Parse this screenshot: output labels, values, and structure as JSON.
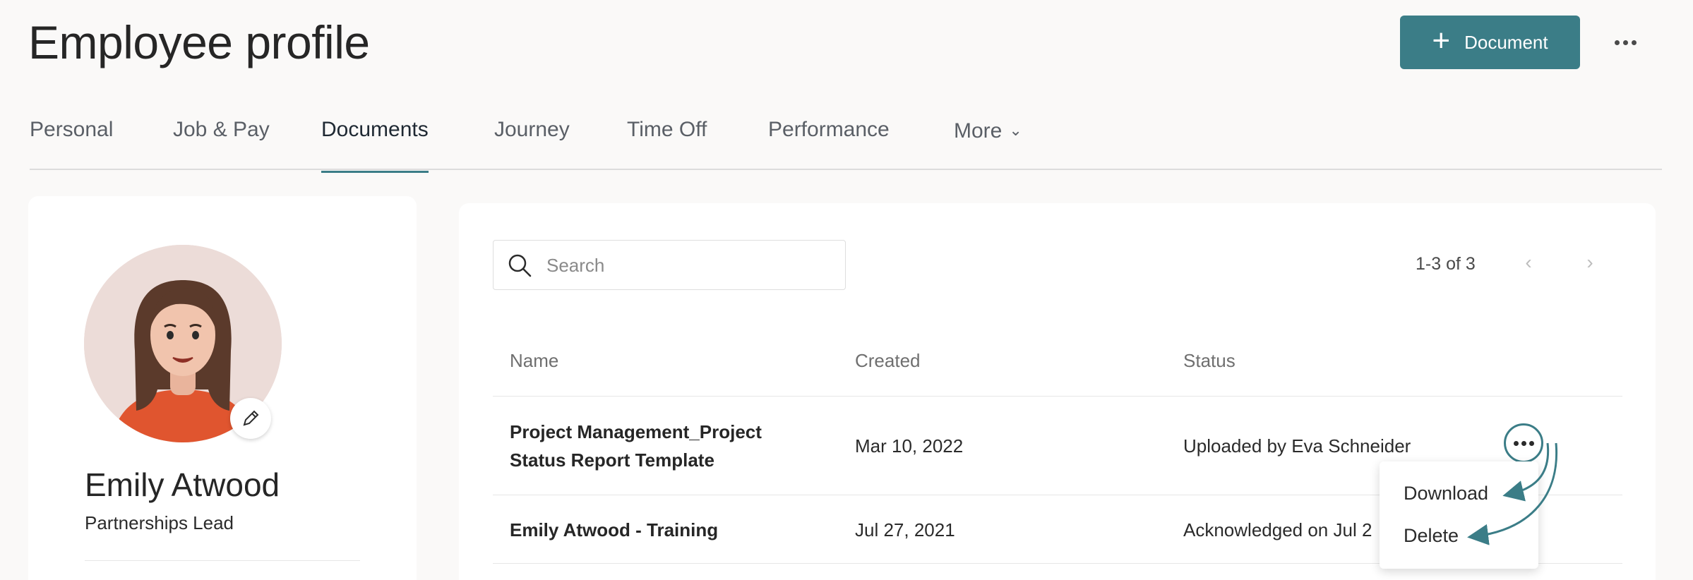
{
  "header": {
    "title": "Employee profile",
    "primary_button_label": "Document"
  },
  "tabs": [
    {
      "label": "Personal",
      "active": false
    },
    {
      "label": "Job & Pay",
      "active": false
    },
    {
      "label": "Documents",
      "active": true
    },
    {
      "label": "Journey",
      "active": false
    },
    {
      "label": "Time Off",
      "active": false
    },
    {
      "label": "Performance",
      "active": false
    },
    {
      "label": "More",
      "active": false
    }
  ],
  "profile": {
    "name": "Emily Atwood",
    "role": "Partnerships Lead"
  },
  "documents": {
    "search_placeholder": "Search",
    "pagination": "1-3 of 3",
    "columns": [
      "Name",
      "Created",
      "Status"
    ],
    "rows": [
      {
        "name_line1": "Project Management_Project",
        "name_line2": "Status Report Template",
        "created": "Mar 10, 2022",
        "status": "Uploaded by Eva Schneider"
      },
      {
        "name_line1": "Emily Atwood - Training",
        "name_line2": "",
        "created": "Jul 27, 2021",
        "status": "Acknowledged on Jul 2"
      }
    ],
    "row_menu": [
      "Download",
      "Delete"
    ]
  },
  "colors": {
    "accent": "#3b7d87",
    "background": "#faf9f8",
    "avatar_bg": "#ecdcd8"
  },
  "icons": {
    "add": "plus-icon",
    "overflow": "more-horizontal-icon",
    "search": "search-icon",
    "edit": "pencil-icon"
  }
}
